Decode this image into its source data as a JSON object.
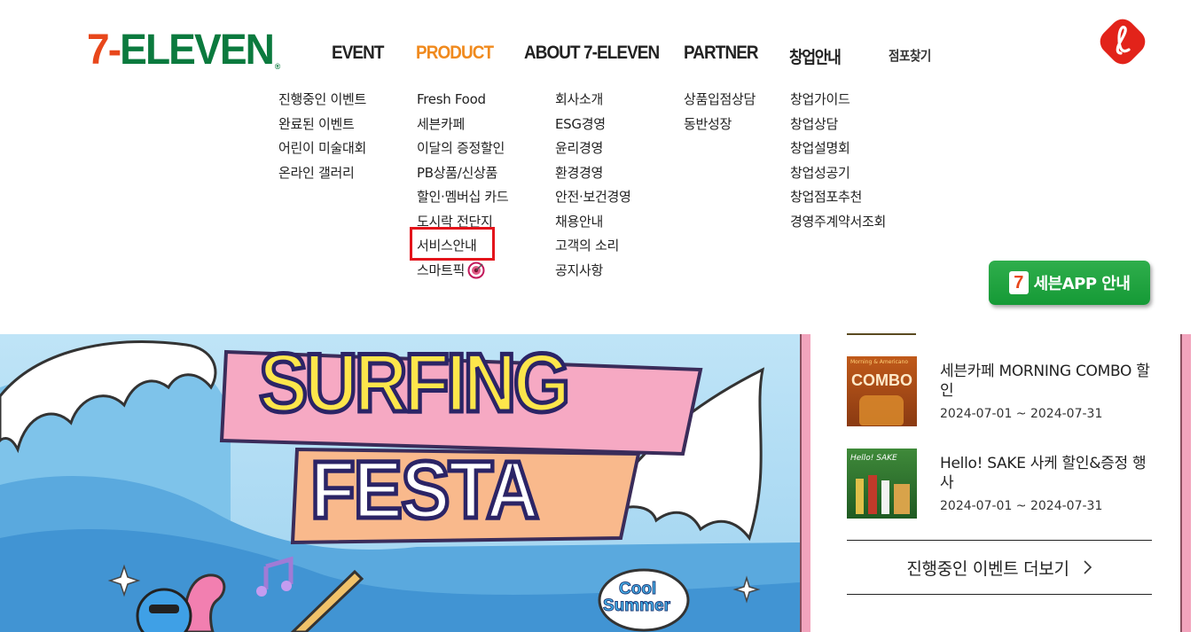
{
  "logo": {
    "seven": "7",
    "dash": "-",
    "word": "ELEVEN",
    "reg": "®"
  },
  "gnb": {
    "event": "EVENT",
    "product": "PRODUCT",
    "about": "ABOUT 7-ELEVEN",
    "partner": "PARTNER",
    "startup": "창업안내",
    "store": "점포찾기"
  },
  "submenu": {
    "event": [
      "진행중인 이벤트",
      "완료된 이벤트",
      "어린이 미술대회",
      "온라인 갤러리"
    ],
    "product": [
      "Fresh Food",
      "세븐카페",
      "이달의 증정할인",
      "PB상품/신상품",
      "할인·멤버십 카드",
      "도시락 전단지",
      "서비스안내",
      "스마트픽"
    ],
    "about": [
      "회사소개",
      "ESG경영",
      "윤리경영",
      "환경경영",
      "안전·보건경영",
      "채용안내",
      "고객의 소리",
      "공지사항"
    ],
    "partner": [
      "상품입점상담",
      "동반성장"
    ],
    "startup": [
      "창업가이드",
      "창업상담",
      "창업설명회",
      "창업성공기",
      "창업점포추천",
      "경영주계약서조회"
    ]
  },
  "app_button": {
    "label": "세븐APP 안내",
    "icon": "7"
  },
  "banner": {
    "line1": "SURFING",
    "line2": "FESTA",
    "badge1": "Cool",
    "badge2": "Summer"
  },
  "events": [
    {
      "title": "세븐카페 MORNING COMBO 할인",
      "date": "2024-07-01 ~ 2024-07-31",
      "thumb_text": "COMBO",
      "thumb_top": "Morning & Americano"
    },
    {
      "title": "Hello! SAKE 사케 할인&증정 행사",
      "date": "2024-07-01 ~ 2024-07-31",
      "thumb_text": "Hello! SAKE"
    }
  ],
  "more": {
    "label": "진행중인 이벤트 더보기",
    "arrow": "chevron-right-icon"
  },
  "colors": {
    "accent_orange": "#f08a1e",
    "brand_green": "#0b7a3e",
    "brand_red": "#e8471b",
    "highlight": "#e3141b",
    "app_green": "#1ea33e",
    "banner_pink": "#f2a4bd"
  }
}
